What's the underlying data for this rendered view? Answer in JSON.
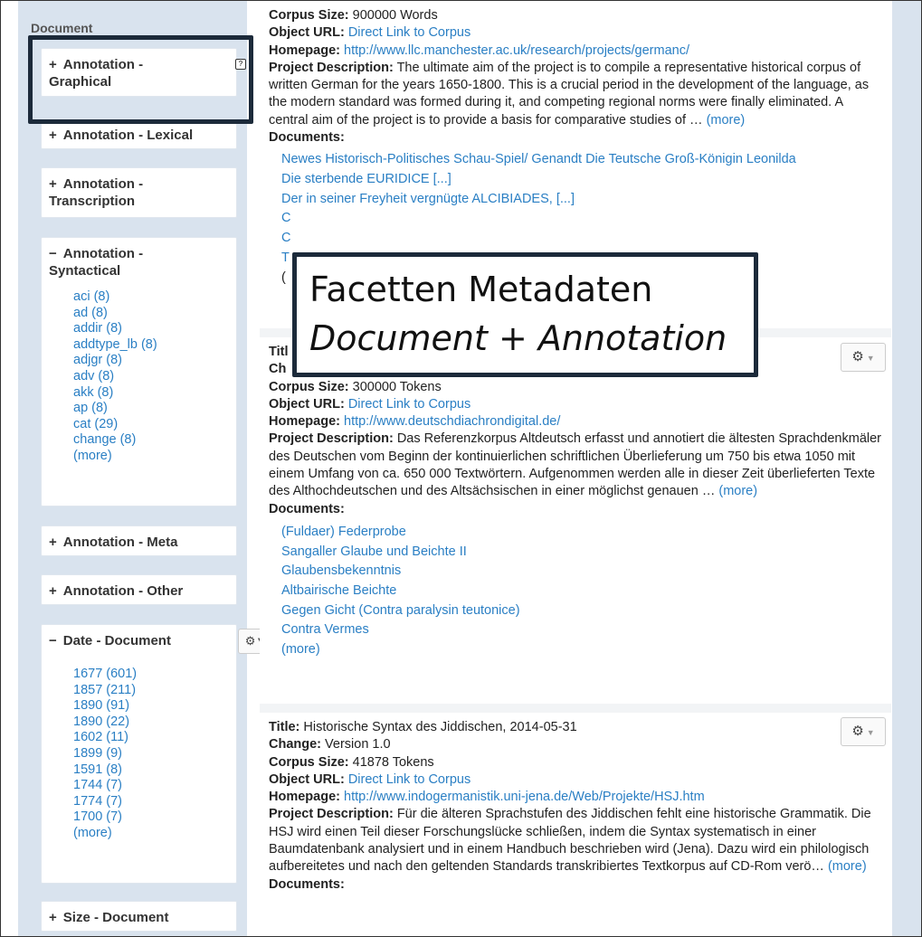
{
  "sidebar": {
    "title": "Document",
    "facets": [
      {
        "symbol": "+",
        "label_line1": "Annotation -",
        "label_line2": "Graphical"
      },
      {
        "symbol": "+",
        "label_line1": "Annotation - Lexical",
        "label_line2": ""
      },
      {
        "symbol": "+",
        "label_line1": "Annotation -",
        "label_line2": "Transcription"
      },
      {
        "symbol": "−",
        "label_line1": "Annotation -",
        "label_line2": "Syntactical",
        "items": [
          "aci (8)",
          "ad (8)",
          "addir (8)",
          "addtype_lb (8)",
          "adjgr (8)",
          "adv (8)",
          "akk (8)",
          "ap (8)",
          "cat (29)",
          "change (8)",
          "(more)"
        ]
      },
      {
        "symbol": "+",
        "label_line1": "Annotation - Meta",
        "label_line2": ""
      },
      {
        "symbol": "+",
        "label_line1": "Annotation - Other",
        "label_line2": ""
      },
      {
        "symbol": "−",
        "label_line1": "Date - Document",
        "label_line2": "",
        "items": [
          "1677 (601)",
          "1857 (211)",
          "1890 (91)",
          "1890 (22)",
          "1602 (11)",
          "1899 (9)",
          "1591 (8)",
          "1744 (7)",
          "1774 (7)",
          "1700 (7)",
          "(more)"
        ]
      },
      {
        "symbol": "+",
        "label_line1": "Size - Document",
        "label_line2": ""
      }
    ]
  },
  "entries": [
    {
      "corpus_size_label": "Corpus Size:",
      "corpus_size": "900000 Words",
      "object_url_label": "Object URL:",
      "object_url": "Direct Link to Corpus",
      "homepage_label": "Homepage:",
      "homepage": "http://www.llc.manchester.ac.uk/research/projects/germanc/",
      "desc_label": "Project Description:",
      "desc": "The ultimate aim of the project is to compile a representative historical corpus of written German for the years 1650-1800. This is a crucial period in the development of the language, as the modern standard was formed during it, and competing regional norms were finally eliminated. A central aim of the project is to provide a basis for comparative studies of …",
      "more": "(more)",
      "documents_label": "Documents:",
      "documents": [
        "Newes Historisch-Politisches Schau-Spiel/ Genandt Die Teutsche Groß-Königin Leonilda",
        "Die sterbende EURIDICE [...]",
        "Der in seiner Freyheit vergnügte ALCIBIADES, [...]",
        "C",
        "C",
        "T",
        "("
      ]
    },
    {
      "title_label": "Titl",
      "change_label": "Ch",
      "corpus_size_label": "Corpus Size:",
      "corpus_size": "300000 Tokens",
      "object_url_label": "Object URL:",
      "object_url": "Direct Link to Corpus",
      "homepage_label": "Homepage:",
      "homepage": "http://www.deutschdiachrondigital.de/",
      "desc_label": "Project Description:",
      "desc": "Das Referenzkorpus Altdeutsch erfasst und annotiert die ältesten Sprachdenkmäler des Deutschen vom Beginn der kontinuierlichen schriftlichen Überlieferung um 750 bis etwa 1050 mit einem Umfang von ca. 650 000 Textwörtern. Aufgenommen werden alle in dieser Zeit überlieferten Texte des Althochdeutschen und des Altsächsischen in einer möglichst genauen …",
      "more": "(more)",
      "documents_label": "Documents:",
      "documents": [
        "(Fuldaer) Federprobe",
        "Sangaller Glaube und Beichte II",
        "Glaubensbekenntnis",
        "Altbairische Beichte",
        "Gegen Gicht (Contra paralysin teutonice)",
        "Contra Vermes",
        "(more)"
      ]
    },
    {
      "title_label": "Title:",
      "title": "Historische Syntax des Jiddischen, 2014-05-31",
      "change_label": "Change:",
      "change": "Version 1.0",
      "corpus_size_label": "Corpus Size:",
      "corpus_size": "41878 Tokens",
      "object_url_label": "Object URL:",
      "object_url": "Direct Link to Corpus",
      "homepage_label": "Homepage:",
      "homepage": "http://www.indogermanistik.uni-jena.de/Web/Projekte/HSJ.htm",
      "desc_label": "Project Description:",
      "desc": "Für die älteren Sprachstufen des Jiddischen fehlt eine historische Grammatik. Die HSJ wird einen Teil dieser Forschungslücke schließen, indem die Syntax systematisch in einer Baumdatenbank analysiert und in einem Handbuch beschrieben wird (Jena). Dazu wird ein philologisch aufbereitetes und nach den geltenden Standards transkribiertes Textkorpus auf CD-Rom verö…",
      "more": "(more)",
      "documents_label": "Documents:"
    }
  ],
  "callout": {
    "line1": "Facetten Metadaten",
    "line2_a": "Document",
    "line2_b": " + ",
    "line2_c": "Annotation"
  },
  "icons": {
    "gear": "gear-icon",
    "caret": "caret-down-icon",
    "comment": "comment-icon"
  },
  "colors": {
    "link": "#2a7fc4",
    "sidebar_bg": "#d9e3ee",
    "callout_border": "#1c2a3a"
  }
}
